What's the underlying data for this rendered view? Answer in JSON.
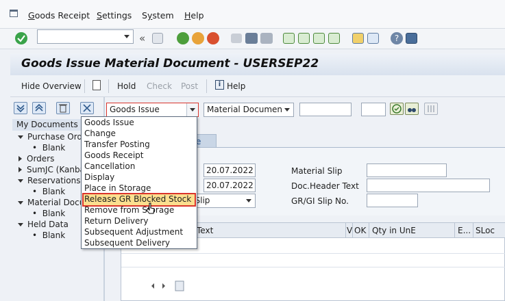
{
  "menu": {
    "items": [
      {
        "label": "Goods Receipt",
        "accel": "G",
        "rest": "oods Receipt"
      },
      {
        "label": "Settings",
        "accel": "S",
        "rest": "ettings"
      },
      {
        "label": "System",
        "accel": "y",
        "pre": "S",
        "rest": "stem"
      },
      {
        "label": "Help",
        "accel": "H",
        "rest": "elp"
      }
    ]
  },
  "toolbar": {
    "command_field_value": "",
    "icons": [
      "enter-icon",
      "back-icon",
      "save-icon",
      "back-green-icon",
      "exit-icon",
      "cancel-icon",
      "print-icon",
      "find-icon",
      "find-next-icon",
      "first-page-icon",
      "prev-page-icon",
      "next-page-icon",
      "last-page-icon",
      "new-session-icon",
      "shortcut-icon",
      "help-icon",
      "layout-icon"
    ]
  },
  "title": "Goods Issue Material Document - USERSEP22",
  "app_toolbar": {
    "hide_overview": "Hide Overview",
    "hold": "Hold",
    "check": "Check",
    "post": "Post",
    "help": "Help"
  },
  "left_panel": {
    "header": "My Documents",
    "tree": [
      {
        "label": "Purchase Orde",
        "state": "expanded"
      },
      {
        "label": "Blank",
        "child": true
      },
      {
        "label": "Orders",
        "state": "collapsed"
      },
      {
        "label": "SumJC (Kanba",
        "state": "collapsed"
      },
      {
        "label": "Reservations",
        "state": "expanded"
      },
      {
        "label": "Blank",
        "child": true
      },
      {
        "label": "Material Docum",
        "state": "expanded"
      },
      {
        "label": "Blank",
        "child": true
      },
      {
        "label": "Held Data",
        "state": "expanded"
      },
      {
        "label": "Blank",
        "child": true
      }
    ]
  },
  "header_fields": {
    "action_value": "Goods Issue",
    "reference_value": "Material Document",
    "field3": "",
    "field4": ""
  },
  "tab_fragment": "e",
  "document_fields": {
    "doc_date": "20.07.2022",
    "posting_date": "20.07.2022",
    "slip_fragment": "al Slip",
    "material_slip_label": "Material Slip",
    "material_slip_value": "",
    "doc_header_text_label": "Doc.Header Text",
    "doc_header_text_value": "",
    "gr_gi_slip_label": "GR/GI Slip No.",
    "gr_gi_slip_value": ""
  },
  "grid": {
    "columns": [
      "Text",
      "V",
      "OK",
      "Qty in UnE",
      "E...",
      "SLoc"
    ]
  },
  "dropdown": {
    "options": [
      "Goods Issue",
      "Change",
      "Transfer Posting",
      "Goods Receipt",
      "Cancellation",
      "Display",
      "Place in Storage",
      "Release GR Blocked Stock",
      "Remove from Storage",
      "Return Delivery",
      "Subsequent Adjustment",
      "Subsequent Delivery"
    ],
    "highlighted": "Release GR Blocked Stock"
  },
  "colors": {
    "highlight_fill": "#fbdf8f",
    "highlight_border": "#d9342b"
  }
}
